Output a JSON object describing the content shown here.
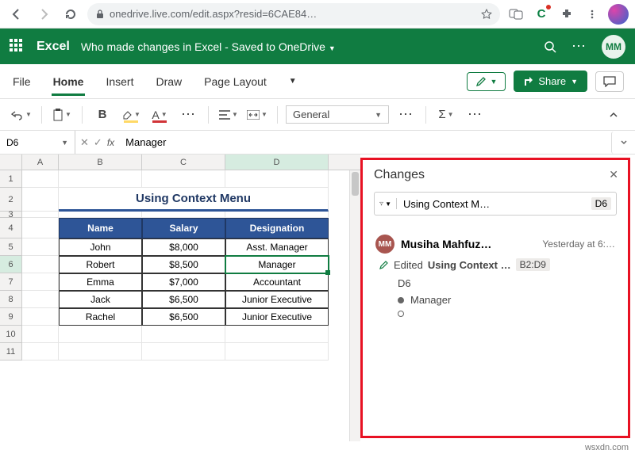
{
  "browser": {
    "url": "onedrive.live.com/edit.aspx?resid=6CAE84…",
    "star_icon": "star",
    "translate_badge": "C"
  },
  "titlebar": {
    "app": "Excel",
    "doc": "Who made changes in Excel - Saved to OneDrive",
    "avatar": "MM",
    "more": "⋯",
    "search": "Search"
  },
  "tabs": {
    "file": "File",
    "home": "Home",
    "insert": "Insert",
    "draw": "Draw",
    "page_layout": "Page Layout",
    "share": "Share"
  },
  "toolbar": {
    "number_format": "General"
  },
  "formula_bar": {
    "namebox": "D6",
    "value": "Manager"
  },
  "grid": {
    "cols": [
      "A",
      "B",
      "C",
      "D"
    ],
    "title": "Using Context Menu",
    "headers": {
      "b": "Name",
      "c": "Salary",
      "d": "Designation"
    },
    "rows": [
      {
        "n": "5",
        "b": "John",
        "c": "$8,000",
        "d": "Asst. Manager"
      },
      {
        "n": "6",
        "b": "Robert",
        "c": "$8,500",
        "d": "Manager"
      },
      {
        "n": "7",
        "b": "Emma",
        "c": "$7,000",
        "d": "Accountant"
      },
      {
        "n": "8",
        "b": "Jack",
        "c": "$6,500",
        "d": "Junior Executive"
      },
      {
        "n": "9",
        "b": "Rachel",
        "c": "$6,500",
        "d": "Junior Executive"
      }
    ],
    "active_cell": "D6"
  },
  "changes": {
    "title": "Changes",
    "filter_sheet": "Using Context M…",
    "filter_cell": "D6",
    "card": {
      "avatar": "MM",
      "author": "Musiha Mahfuz…",
      "time": "Yesterday at 6:…",
      "action": "Edited",
      "sheet": "Using Context …",
      "range": "B2:D9",
      "cell": "D6",
      "new_value": "Manager"
    }
  },
  "watermark": "wsxdn.com"
}
